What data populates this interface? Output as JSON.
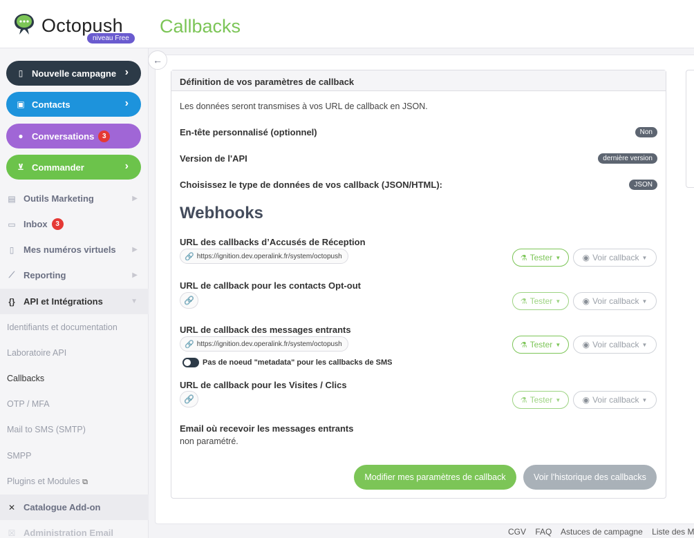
{
  "header": {
    "brand": "Octopush",
    "level": "niveau Free",
    "page_title": "Callbacks"
  },
  "sidebar": {
    "buttons": [
      {
        "label": "Nouvelle campagne",
        "icon": "phone-icon",
        "color": "#2c3a47"
      },
      {
        "label": "Contacts",
        "icon": "contacts-book-icon",
        "color": "#1d93dc"
      },
      {
        "label": "Conversations",
        "icon": "chat-bubbles-icon",
        "color": "#a066d6",
        "badge": "3"
      },
      {
        "label": "Commander",
        "icon": "cart-icon",
        "color": "#6cc34b"
      }
    ],
    "items": [
      {
        "label": "Outils Marketing",
        "icon": "newspaper-icon"
      },
      {
        "label": "Inbox",
        "icon": "inbox-icon",
        "badge": "3"
      },
      {
        "label": "Mes numéros virtuels",
        "icon": "mobile-icon"
      },
      {
        "label": "Reporting",
        "icon": "chart-icon"
      },
      {
        "label": "API et Intégrations",
        "icon": "code-braces-icon"
      },
      {
        "label": "Catalogue Add-on",
        "icon": "tools-icon"
      },
      {
        "label": "Administration Email",
        "icon": "email-icon"
      }
    ],
    "api_sub_items": [
      "Identifiants et documentation",
      "Laboratoire API",
      "Callbacks",
      "OTP / MFA",
      "Mail to SMS (SMTP)",
      "SMPP",
      "Plugins et Modules"
    ]
  },
  "card": {
    "title": "Définition de vos paramètres de callback",
    "intro": "Les données seront transmises à vos URL de callback en JSON.",
    "custom_header_label": "En-tête personnalisé (optionnel)",
    "custom_header_value": "Non",
    "api_version_label": "Version de l'API",
    "api_version_value": "dernière version",
    "data_type_label": "Choisissez le type de données de vos callback (JSON/HTML):",
    "data_type_value": "JSON",
    "webhooks_title": "Webhooks",
    "webhooks": [
      {
        "label": "URL des callbacks d’Accusés de Réception",
        "url": "https://ignition.dev.operalink.fr/system/octopush"
      },
      {
        "label": "URL de callback pour les contacts Opt-out",
        "url": ""
      },
      {
        "label": "URL de callback des messages entrants",
        "url": "https://ignition.dev.operalink.fr/system/octopush"
      },
      {
        "label": "URL de callback pour les Visites / Clics",
        "url": ""
      }
    ],
    "test_label": "Tester",
    "view_label": "Voir callback",
    "metadata_toggle_label": "Pas de noeud \"metadata\" pour les callbacks de SMS",
    "email_label": "Email où recevoir les messages entrants",
    "email_value": "non paramétré.",
    "primary_button": "Modifier mes paramètres de callback",
    "secondary_button": "Voir l'historique des callbacks"
  },
  "footer": {
    "links": [
      "CGV",
      "FAQ",
      "Astuces de campagne",
      "Liste des M"
    ]
  }
}
